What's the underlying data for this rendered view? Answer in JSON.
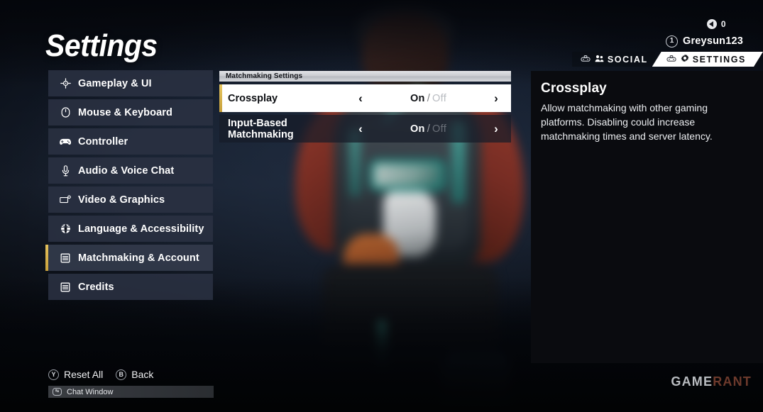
{
  "page_title": "Settings",
  "hud": {
    "currency_icon": "coin-icon",
    "currency_count": "0",
    "level": "1",
    "player_name": "Greysun123",
    "tabs": [
      {
        "label": "SOCIAL",
        "icon": "button-prompt-icon",
        "glyph": "social-people-icon",
        "active": false
      },
      {
        "label": "SETTINGS",
        "icon": "button-prompt-icon",
        "glyph": "gear-icon",
        "active": true
      }
    ]
  },
  "sidebar": {
    "items": [
      {
        "label": "Gameplay & UI",
        "icon": "crosshair-icon",
        "selected": false
      },
      {
        "label": "Mouse & Keyboard",
        "icon": "mouse-icon",
        "selected": false
      },
      {
        "label": "Controller",
        "icon": "gamepad-icon",
        "selected": false
      },
      {
        "label": "Audio & Voice Chat",
        "icon": "microphone-icon",
        "selected": false
      },
      {
        "label": "Video & Graphics",
        "icon": "monitor-icon",
        "selected": false
      },
      {
        "label": "Language & Accessibility",
        "icon": "globe-icon",
        "selected": false
      },
      {
        "label": "Matchmaking & Account",
        "icon": "list-icon",
        "selected": true
      },
      {
        "label": "Credits",
        "icon": "list-icon",
        "selected": false
      }
    ]
  },
  "panel": {
    "header": "Matchmaking Settings",
    "options": [
      {
        "label": "Crossplay",
        "left_arrow": "‹",
        "right_arrow": "›",
        "value_on": "On",
        "separator": "/",
        "value_off": "Off",
        "selected_value": "On",
        "active": true
      },
      {
        "label": "Input-Based Matchmaking",
        "left_arrow": "‹",
        "right_arrow": "›",
        "value_on": "On",
        "separator": "/",
        "value_off": "Off",
        "selected_value": "On",
        "active": false
      }
    ]
  },
  "description": {
    "title": "Crossplay",
    "body": "Allow matchmaking with other gaming platforms. Disabling could increase matchmaking times and server latency."
  },
  "bottom_bar": {
    "prompts": [
      {
        "key": "Y",
        "label": "Reset All"
      },
      {
        "key": "B",
        "label": "Back"
      }
    ],
    "chat": {
      "key": "↹",
      "label": "Chat Window"
    }
  },
  "watermark": {
    "part1": "GAME",
    "part2": "RANT"
  },
  "colors": {
    "accent_gold": "#e3c05a",
    "panel_active_bg": "#ffffff",
    "sidebar_bg": "#2a3142",
    "description_bg": "#0a0b0f"
  }
}
